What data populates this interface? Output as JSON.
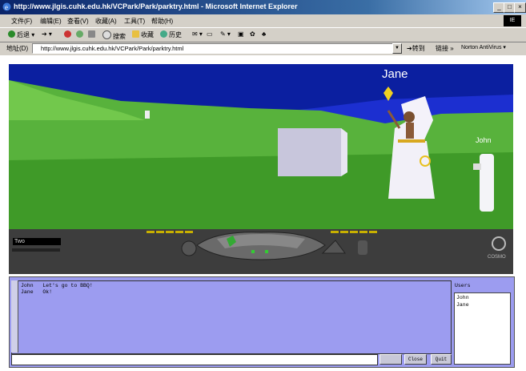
{
  "window": {
    "title": "http://www.jlgis.cuhk.edu.hk/VCPark/Park/parktry.html - Microsoft Internet Explorer"
  },
  "menu": [
    "文件(F)",
    "编辑(E)",
    "查看(V)",
    "收藏(A)",
    "工具(T)",
    "帮助(H)"
  ],
  "throbber_label": "IE",
  "toolbar": {
    "back": "后退",
    "search": "搜索",
    "favorites": "收藏",
    "history": "历史"
  },
  "address": {
    "label": "地址(D)",
    "url": "http://www.jlgis.cuhk.edu.hk/VCPark/Park/parktry.html",
    "go": "转到",
    "links": "链接",
    "norton": "Norton AntiVirus"
  },
  "scene": {
    "avatar_jane": "Jane",
    "avatar_john": "John"
  },
  "dashboard": {
    "viewpoint": "Two"
  },
  "chat": {
    "messages": [
      {
        "user": "John",
        "text": "Let's go to BBQ!"
      },
      {
        "user": "Jane",
        "text": "Ok!"
      }
    ],
    "users_label": "Users",
    "users": [
      "John",
      "Jane"
    ],
    "buttons": {
      "send": "",
      "close": "Close",
      "quit": "Quit"
    }
  }
}
